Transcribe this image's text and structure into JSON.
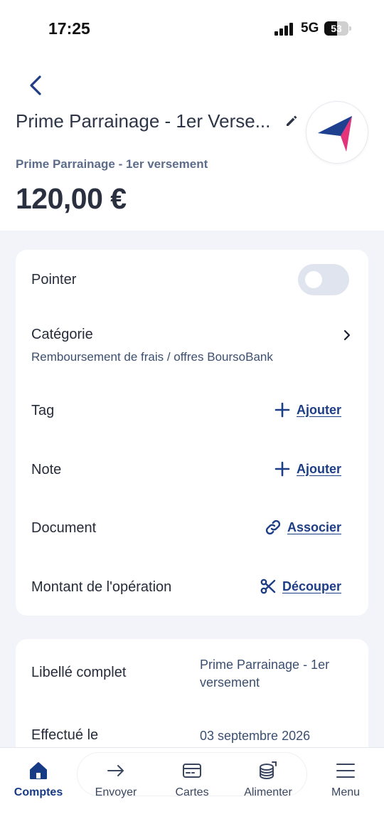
{
  "status_bar": {
    "time": "17:25",
    "network": "5G",
    "battery": "53",
    "battery_level_percent": 53
  },
  "header": {
    "title": "Prime Parrainage - 1er Verse...",
    "subtitle": "Prime Parrainage - 1er versement",
    "amount": "120,00 €"
  },
  "details_card": {
    "pointer": {
      "label": "Pointer",
      "checked": false
    },
    "category": {
      "label": "Catégorie",
      "value": "Remboursement de frais / offres BoursoBank"
    },
    "tag": {
      "label": "Tag",
      "action": "Ajouter"
    },
    "note": {
      "label": "Note",
      "action": "Ajouter"
    },
    "document": {
      "label": "Document",
      "action": "Associer"
    },
    "amount_row": {
      "label": "Montant de l'opération",
      "action": "Découper"
    }
  },
  "info_card": {
    "full_label": {
      "label": "Libellé complet",
      "value_line1": "Prime Parrainage - 1er",
      "value_line2": "versement"
    },
    "date": {
      "label": "Effectué le",
      "value": "03 septembre 2026"
    }
  },
  "bottom_nav": {
    "items": [
      {
        "label": "Comptes",
        "icon": "home-icon",
        "active": true
      },
      {
        "label": "Envoyer",
        "icon": "arrow-right-icon",
        "active": false
      },
      {
        "label": "Cartes",
        "icon": "card-icon",
        "active": false
      },
      {
        "label": "Alimenter",
        "icon": "coins-icon",
        "active": false
      },
      {
        "label": "Menu",
        "icon": "menu-icon",
        "active": false
      }
    ]
  },
  "colors": {
    "accent": "#1d3e86",
    "background": "#f2f4fa",
    "logo_blue": "#1f3f8f",
    "logo_cyan": "#2aa6d8",
    "logo_pink": "#e4337a"
  }
}
